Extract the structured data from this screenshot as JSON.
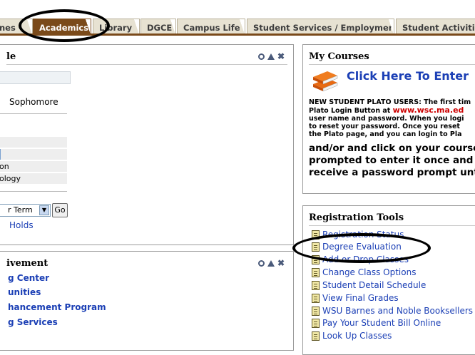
{
  "tabs": [
    {
      "label": "nes",
      "active": false
    },
    {
      "label": "Academics",
      "active": true
    },
    {
      "label": "Library",
      "active": false
    },
    {
      "label": "DGCE",
      "active": false
    },
    {
      "label": "Campus Life",
      "active": false
    },
    {
      "label": "Student Services / Employment",
      "active": false
    },
    {
      "label": "Student Activitie",
      "active": false
    }
  ],
  "left_panel": {
    "title_fragment": "le",
    "class_level": "Sophomore",
    "rows": [
      "",
      "",
      "on",
      "ology"
    ],
    "term_select": "r Term",
    "go_label": "Go",
    "holds_link": "Holds"
  },
  "achievement_panel": {
    "title_fragment": "ivement",
    "links": [
      "g Center",
      "unities",
      "hancement Program",
      "g Services"
    ]
  },
  "my_courses": {
    "title": "My Courses",
    "enter_link": "Click Here To Enter",
    "notice_lines": [
      "NEW STUDENT PLATO USERS: The first tim",
      "Plato Login Button at www.wsc.ma.ed",
      "user name and password. When you logi",
      "to reset your password. Once you reset",
      "the Plato page, and you can login to Pla"
    ],
    "notice_url": "www.wsc.ma.ed",
    "big_lines": [
      "and/or and click on your course",
      "prompted to enter it once and",
      "receive a password prompt unt"
    ]
  },
  "registration_tools": {
    "title": "Registration Tools",
    "items": [
      "Registration Status",
      "Degree Evaluation",
      "Add or Drop Classes",
      "Change Class Options",
      "Student Detail Schedule",
      "View Final Grades",
      "WSU Barnes and Noble Booksellers",
      "Pay Your Student Bill Online",
      "Look Up Classes"
    ]
  },
  "colors": {
    "tab_active": "#7a4a1a",
    "link": "#1b3fb5",
    "url_red": "#cc0000"
  },
  "icons": [
    "search-icon",
    "minimize-icon",
    "close-icon",
    "book-stack-icon",
    "document-icon"
  ]
}
